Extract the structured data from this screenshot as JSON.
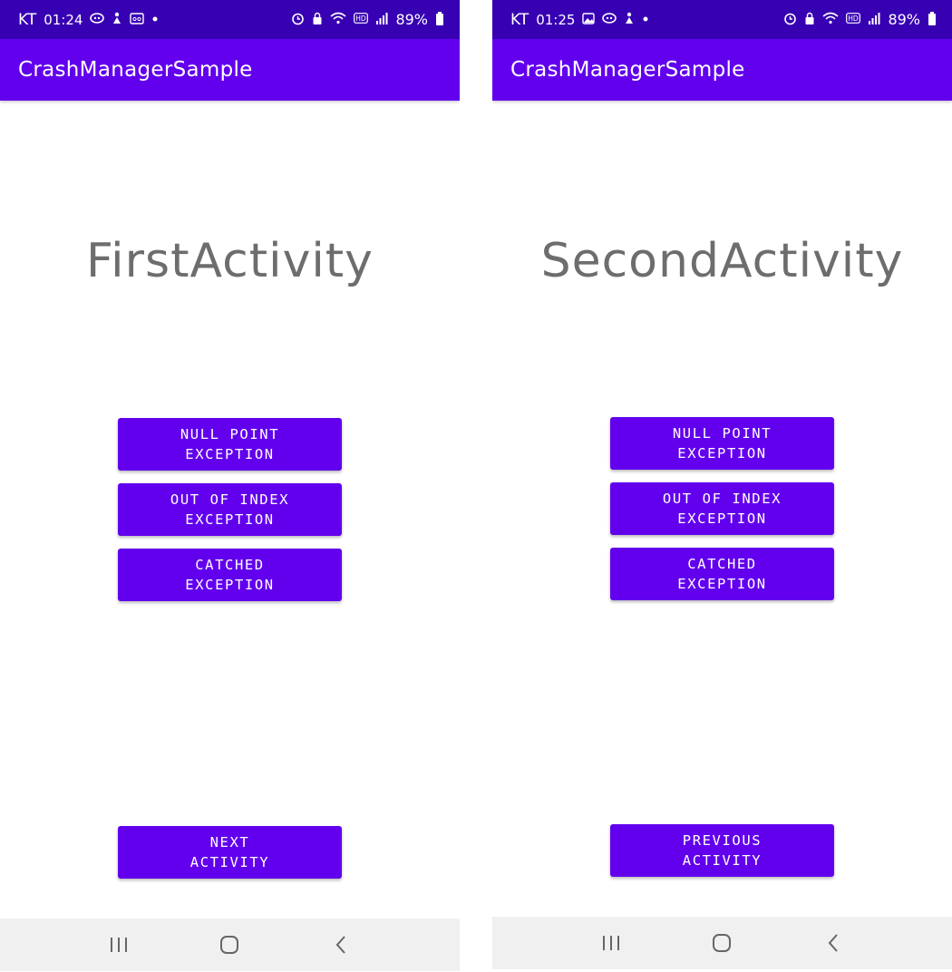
{
  "colors": {
    "status_bar": "#3700b3",
    "app_bar": "#6200ee",
    "button": "#6200ee",
    "title_text": "#6d6d6d",
    "nav_bar": "#f0f0f0"
  },
  "screens": [
    {
      "status": {
        "carrier": "KT",
        "time": "01:24",
        "battery": "89%",
        "left_icons": [
          "messenger-icon",
          "figure-icon",
          "voicemail-icon",
          "dot-icon"
        ],
        "right_icons": [
          "alarm-icon",
          "lock-icon",
          "wifi-icon",
          "hd-icon",
          "signal-icon",
          "battery-icon"
        ]
      },
      "app_title": "CrashManagerSample",
      "activity_title": "FirstActivity",
      "buttons": [
        "NULL POINT\nEXCEPTION",
        "OUT OF INDEX\nEXCEPTION",
        "CATCHED\nEXCEPTION"
      ],
      "nav_button": "NEXT\nACTIVITY",
      "nav_icons": [
        "recents-icon",
        "home-icon",
        "back-icon"
      ]
    },
    {
      "status": {
        "carrier": "KT",
        "time": "01:25",
        "battery": "89%",
        "left_icons": [
          "gallery-icon",
          "messenger-icon",
          "figure-icon",
          "dot-icon"
        ],
        "right_icons": [
          "alarm-icon",
          "lock-icon",
          "wifi-icon",
          "hd-icon",
          "signal-icon",
          "battery-icon"
        ]
      },
      "app_title": "CrashManagerSample",
      "activity_title": "SecondActivity",
      "buttons": [
        "NULL POINT\nEXCEPTION",
        "OUT OF INDEX\nEXCEPTION",
        "CATCHED\nEXCEPTION"
      ],
      "nav_button": "PREVIOUS\nACTIVITY",
      "nav_icons": [
        "recents-icon",
        "home-icon",
        "back-icon"
      ]
    }
  ]
}
